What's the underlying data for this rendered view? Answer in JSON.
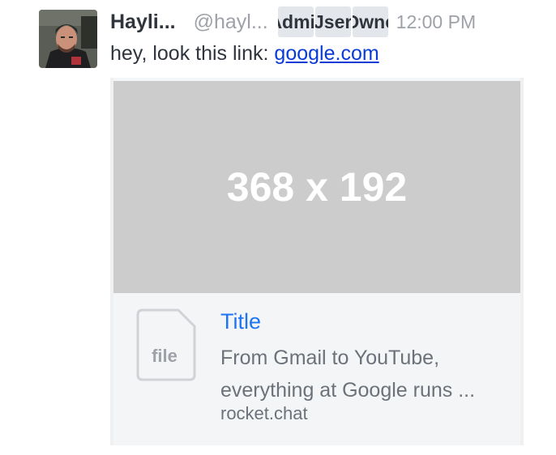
{
  "message": {
    "author_name": "Hayli...",
    "username": "@hayl...",
    "roles": [
      "Admir",
      "Jser",
      "Owne"
    ],
    "time": "12:00 PM",
    "text_prefix": "hey, look this link:",
    "link_text": "google.com"
  },
  "preview": {
    "image_placeholder": "368 x 192",
    "file_icon_label": "file",
    "title": "Title",
    "description_lines": [
      "From Gmail to YouTube,",
      "everything at Google runs ..."
    ],
    "host": "rocket.chat"
  },
  "colors": {
    "link": "#0a3bd6",
    "preview_title": "#1d74f5",
    "image_placeholder_bg": "#cccccc",
    "role_badge_bg": "#e3e6ea"
  },
  "icons": {
    "avatar": "user-avatar",
    "file": "file-icon"
  }
}
